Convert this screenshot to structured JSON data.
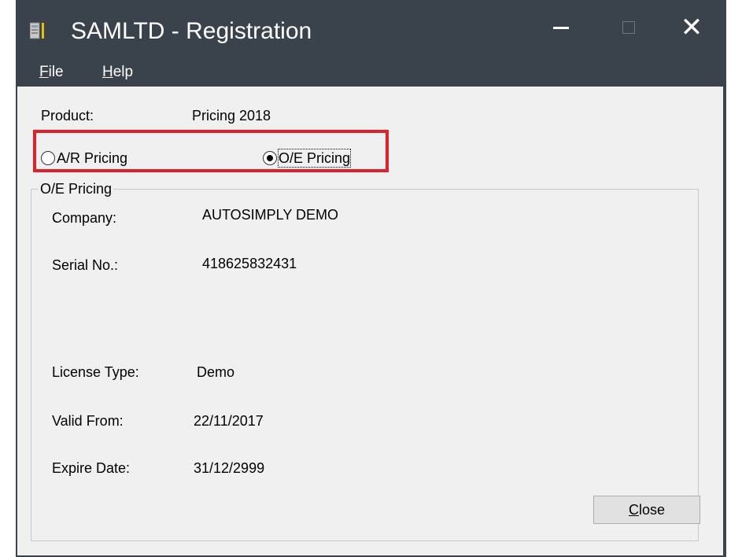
{
  "window": {
    "title": "SAMLTD - Registration",
    "icon": "app-icon"
  },
  "titlebar_buttons": {
    "minimize_icon": "minimize-icon",
    "maximize_icon": "maximize-icon",
    "close_icon": "close-icon",
    "close_glyph": "✕"
  },
  "menu": {
    "file": {
      "mnemonic": "F",
      "rest": "ile"
    },
    "help": {
      "mnemonic": "H",
      "rest": "elp"
    }
  },
  "product": {
    "label": "Product:",
    "value": "Pricing 2018"
  },
  "pricing_options": {
    "ar": {
      "label": "A/R Pricing",
      "selected": false
    },
    "oe": {
      "label": "O/E Pricing",
      "selected": true
    }
  },
  "group": {
    "title": "O/E Pricing",
    "fields": {
      "company": {
        "label": "Company:",
        "value": "AUTOSIMPLY DEMO"
      },
      "serial": {
        "label": "Serial No.:",
        "value": "418625832431"
      },
      "license": {
        "label": "License Type:",
        "value": "Demo"
      },
      "valid_from": {
        "label": "Valid From:",
        "value": "22/11/2017"
      },
      "expire": {
        "label": "Expire Date:",
        "value": "31/12/2999"
      }
    }
  },
  "close_button": {
    "mnemonic": "C",
    "rest": "lose"
  },
  "colors": {
    "titlebar": "#3a434b",
    "client": "#f0f0f0",
    "highlight": "#e3202a"
  }
}
